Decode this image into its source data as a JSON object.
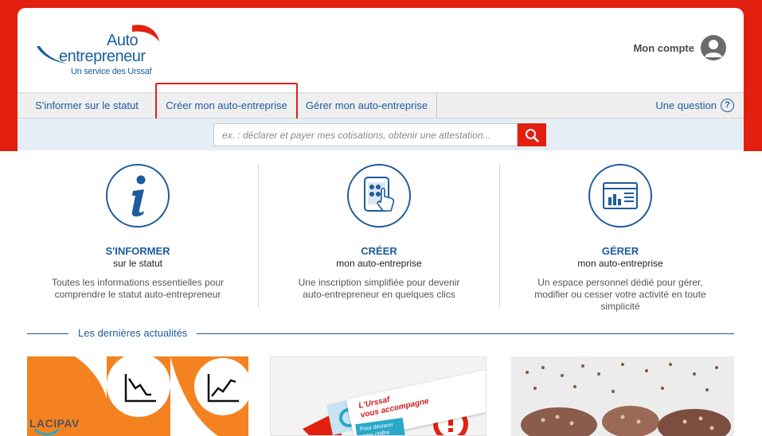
{
  "header": {
    "logo": {
      "line1": "Auto",
      "line2": "entrepreneur",
      "tagline": "Un service des Urssaf"
    },
    "account_label": "Mon compte"
  },
  "nav": {
    "items": [
      {
        "label": "S'informer sur le statut"
      },
      {
        "label": "Créer mon auto-entreprise"
      },
      {
        "label": "Gérer mon auto-entreprise"
      }
    ],
    "question_label": "Une question",
    "question_icon": "?"
  },
  "search": {
    "placeholder": "ex. : déclarer et payer mes cotisations, obtenir une attestation..."
  },
  "features": [
    {
      "title": "S'INFORMER",
      "subtitle": "sur le statut",
      "desc": "Toutes les informations essentielles pour comprendre le statut auto-entrepreneur"
    },
    {
      "title": "CRÉER",
      "subtitle": "mon auto-entreprise",
      "desc": "Une inscription simplifiée pour devenir auto-entrepreneur en quelques clics"
    },
    {
      "title": "GÉRER",
      "subtitle": "mon auto-entreprise",
      "desc": "Un espace personnel dédié pour gérer, modifier ou cesser votre activité en toute simplicité"
    }
  ],
  "news": {
    "title": "Les dernières actualités",
    "cards": [
      {
        "logo_text": "LACIPAV"
      },
      {
        "tag_line1": "L'Urssaf",
        "tag_line2": "vous accompagne",
        "small_line1": "Pour déclarer",
        "small_line2": "votre chiffre"
      },
      {}
    ]
  },
  "colors": {
    "brand_red": "#e3200f",
    "brand_blue": "#1d5b9c",
    "cipav_orange": "#f58220"
  }
}
